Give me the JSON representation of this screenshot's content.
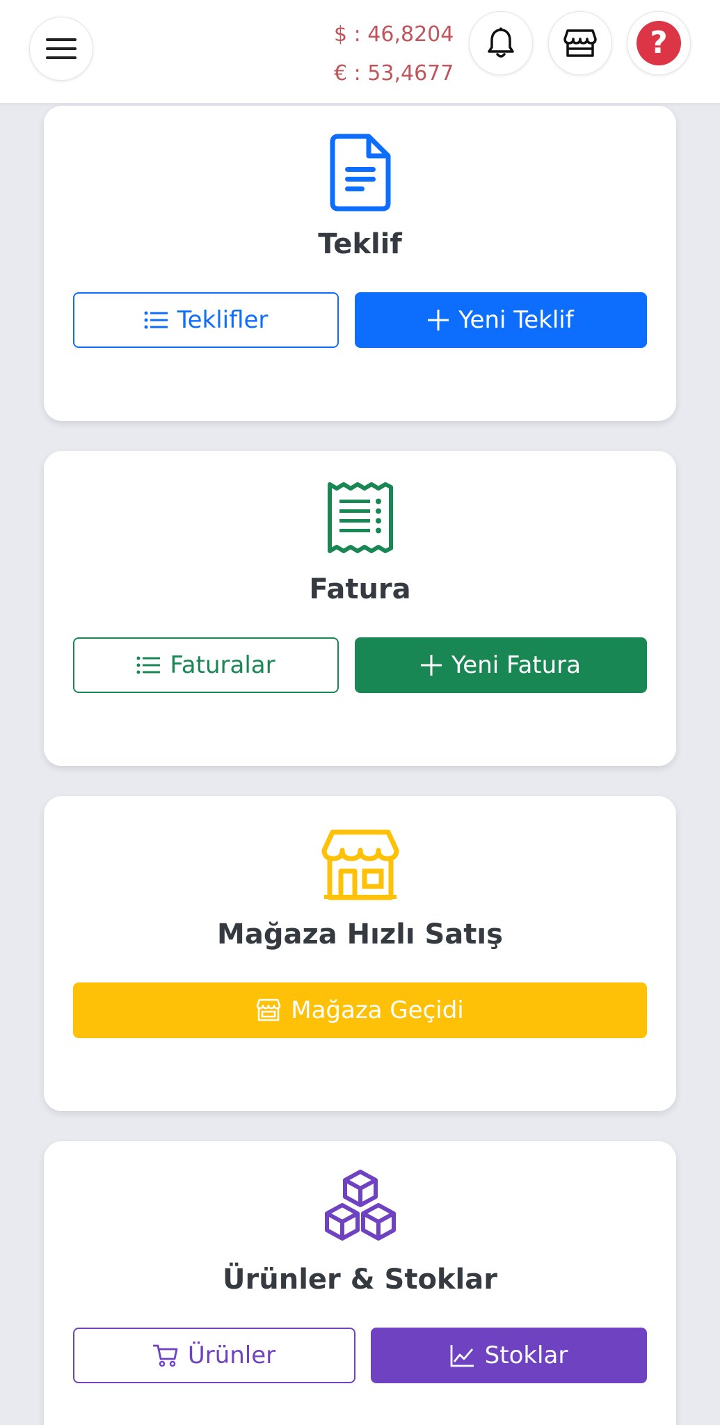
{
  "header": {
    "rates": {
      "usd": "$ : 46,8204",
      "eur": "€ : 53,4677"
    },
    "help_label": "?"
  },
  "cards": [
    {
      "title": "Teklif",
      "icon": "document-icon",
      "color": "#0d6efd",
      "list_button": "Teklifler",
      "new_button": "Yeni Teklif"
    },
    {
      "title": "Fatura",
      "icon": "receipt-icon",
      "color": "#198754",
      "list_button": "Faturalar",
      "new_button": "Yeni Fatura"
    },
    {
      "title": "Mağaza Hızlı Satış",
      "icon": "shop-icon",
      "color": "#ffc107",
      "main_button": "Mağaza Geçidi"
    },
    {
      "title": "Ürünler & Stoklar",
      "icon": "boxes-icon",
      "color": "#6f42c1",
      "products_button": "Ürünler",
      "stocks_button": "Stoklar"
    }
  ]
}
